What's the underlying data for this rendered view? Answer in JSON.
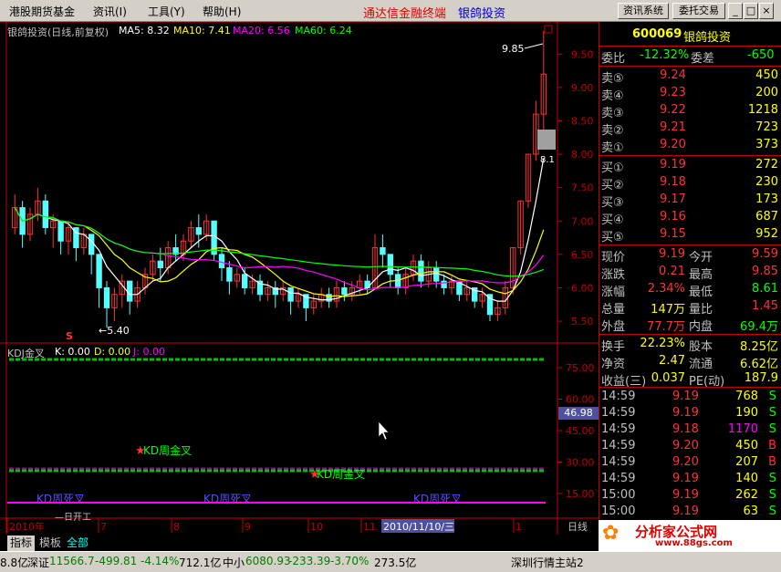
{
  "menu": {
    "items": [
      "港股期货基金",
      "资讯(I)",
      "工具(Y)",
      "帮助(H)"
    ],
    "title_main": "通达信金融终端",
    "title_stock": "银鸽投资",
    "right_buttons": [
      "资讯系统",
      "委托交易"
    ]
  },
  "chart_header": {
    "name": "银鸽投资(日线,前复权)",
    "ma5": "MA5: 8.32",
    "ma10": "MA10: 7.41",
    "ma20": "MA20: 6.56",
    "ma60": "MA60: 6.24"
  },
  "kdj_header": {
    "name": "KDJ金叉",
    "k": "K: 0.00",
    "d": "D: 0.00",
    "j": "J: 0.00"
  },
  "annotations": {
    "high_label": "9.85",
    "low_label": "←5.40",
    "current_price_tag": "8.1",
    "s_marker": "S",
    "kdj_value": "46.98",
    "golden_cross_1": "KD周金叉",
    "golden_cross_2": "KD周金叉",
    "death_cross_1": "KD周死叉",
    "death_cross_2": "KD周死叉",
    "death_cross_3": "KD周死叉",
    "partial_text": "—日开工"
  },
  "colors": {
    "ma5": "#ffffff",
    "ma10": "#ffff00",
    "ma20": "#ff00ff",
    "ma60": "#00ff00",
    "up": "#ff3232",
    "down": "#54ffff",
    "axis": "#c00000"
  },
  "chart_data": {
    "type": "candlestick",
    "price_axis_ticks": [
      "9.50",
      "9.00",
      "8.50",
      "8.00",
      "7.50",
      "7.00",
      "6.50",
      "6.00",
      "5.50"
    ],
    "kdj_axis_ticks": [
      "75.00",
      "60.00",
      "45.00",
      "30.00",
      "15.00"
    ],
    "ylim": [
      5.2,
      9.9
    ],
    "kdj_ylim": [
      5,
      85
    ],
    "x_labels": [
      "2010年",
      "7",
      "8",
      "9",
      "10",
      "11",
      "2010/11/10/三",
      "1",
      "日线"
    ],
    "candles": [
      {
        "o": 6.9,
        "c": 7.2,
        "h": 7.4,
        "l": 6.8
      },
      {
        "o": 7.2,
        "c": 6.8,
        "h": 7.3,
        "l": 6.6
      },
      {
        "o": 6.8,
        "c": 7.1,
        "h": 7.2,
        "l": 6.7
      },
      {
        "o": 7.1,
        "c": 7.3,
        "h": 7.5,
        "l": 7.0
      },
      {
        "o": 7.3,
        "c": 6.9,
        "h": 7.4,
        "l": 6.8
      },
      {
        "o": 6.9,
        "c": 7.0,
        "h": 7.1,
        "l": 6.6
      },
      {
        "o": 7.0,
        "c": 6.7,
        "h": 7.0,
        "l": 6.5
      },
      {
        "o": 6.7,
        "c": 6.9,
        "h": 7.0,
        "l": 6.5
      },
      {
        "o": 6.9,
        "c": 6.6,
        "h": 6.9,
        "l": 6.4
      },
      {
        "o": 6.6,
        "c": 6.8,
        "h": 6.9,
        "l": 6.5
      },
      {
        "o": 6.8,
        "c": 6.5,
        "h": 6.8,
        "l": 6.2
      },
      {
        "o": 6.5,
        "c": 6.0,
        "h": 6.5,
        "l": 5.7
      },
      {
        "o": 6.0,
        "c": 5.7,
        "h": 6.1,
        "l": 5.4
      },
      {
        "o": 5.7,
        "c": 5.9,
        "h": 6.0,
        "l": 5.5
      },
      {
        "o": 5.9,
        "c": 6.1,
        "h": 6.2,
        "l": 5.7
      },
      {
        "o": 6.1,
        "c": 5.8,
        "h": 6.1,
        "l": 5.6
      },
      {
        "o": 5.8,
        "c": 6.0,
        "h": 6.1,
        "l": 5.7
      },
      {
        "o": 6.0,
        "c": 6.2,
        "h": 6.3,
        "l": 5.9
      },
      {
        "o": 6.2,
        "c": 6.4,
        "h": 6.5,
        "l": 6.1
      },
      {
        "o": 6.4,
        "c": 6.3,
        "h": 6.6,
        "l": 6.1
      },
      {
        "o": 6.3,
        "c": 6.6,
        "h": 6.7,
        "l": 6.2
      },
      {
        "o": 6.6,
        "c": 6.5,
        "h": 6.8,
        "l": 6.4
      },
      {
        "o": 6.5,
        "c": 6.7,
        "h": 6.8,
        "l": 6.4
      },
      {
        "o": 6.7,
        "c": 6.9,
        "h": 7.0,
        "l": 6.6
      },
      {
        "o": 6.9,
        "c": 6.8,
        "h": 7.1,
        "l": 6.6
      },
      {
        "o": 6.8,
        "c": 7.0,
        "h": 7.1,
        "l": 6.7
      },
      {
        "o": 7.0,
        "c": 6.5,
        "h": 7.0,
        "l": 6.4
      },
      {
        "o": 6.5,
        "c": 6.3,
        "h": 6.6,
        "l": 6.1
      },
      {
        "o": 6.3,
        "c": 6.1,
        "h": 6.4,
        "l": 5.9
      },
      {
        "o": 6.1,
        "c": 6.2,
        "h": 6.3,
        "l": 6.0
      },
      {
        "o": 6.2,
        "c": 6.0,
        "h": 6.3,
        "l": 5.9
      },
      {
        "o": 6.0,
        "c": 6.1,
        "h": 6.2,
        "l": 5.9
      },
      {
        "o": 6.1,
        "c": 5.9,
        "h": 6.2,
        "l": 5.8
      },
      {
        "o": 5.9,
        "c": 6.0,
        "h": 6.1,
        "l": 5.8
      },
      {
        "o": 6.0,
        "c": 5.9,
        "h": 6.1,
        "l": 5.7
      },
      {
        "o": 5.9,
        "c": 6.0,
        "h": 6.1,
        "l": 5.8
      },
      {
        "o": 6.0,
        "c": 5.8,
        "h": 6.0,
        "l": 5.6
      },
      {
        "o": 5.8,
        "c": 5.9,
        "h": 6.0,
        "l": 5.7
      },
      {
        "o": 5.9,
        "c": 5.7,
        "h": 5.9,
        "l": 5.5
      },
      {
        "o": 5.7,
        "c": 5.8,
        "h": 5.9,
        "l": 5.6
      },
      {
        "o": 5.8,
        "c": 5.9,
        "h": 6.0,
        "l": 5.7
      },
      {
        "o": 5.9,
        "c": 5.8,
        "h": 6.0,
        "l": 5.7
      },
      {
        "o": 5.8,
        "c": 6.0,
        "h": 6.1,
        "l": 5.7
      },
      {
        "o": 6.0,
        "c": 5.9,
        "h": 6.1,
        "l": 5.8
      },
      {
        "o": 5.9,
        "c": 6.0,
        "h": 6.1,
        "l": 5.8
      },
      {
        "o": 6.0,
        "c": 6.1,
        "h": 6.2,
        "l": 5.9
      },
      {
        "o": 6.1,
        "c": 6.0,
        "h": 6.2,
        "l": 5.9
      },
      {
        "o": 6.0,
        "c": 6.6,
        "h": 6.8,
        "l": 6.0
      },
      {
        "o": 6.6,
        "c": 6.5,
        "h": 6.8,
        "l": 6.3
      },
      {
        "o": 6.5,
        "c": 6.2,
        "h": 6.5,
        "l": 6.0
      },
      {
        "o": 6.2,
        "c": 6.0,
        "h": 6.3,
        "l": 5.9
      },
      {
        "o": 6.0,
        "c": 6.2,
        "h": 6.3,
        "l": 5.9
      },
      {
        "o": 6.2,
        "c": 6.4,
        "h": 6.5,
        "l": 6.1
      },
      {
        "o": 6.4,
        "c": 6.1,
        "h": 6.5,
        "l": 6.0
      },
      {
        "o": 6.1,
        "c": 6.3,
        "h": 6.4,
        "l": 6.0
      },
      {
        "o": 6.3,
        "c": 6.1,
        "h": 6.4,
        "l": 6.0
      },
      {
        "o": 6.1,
        "c": 6.0,
        "h": 6.2,
        "l": 5.9
      },
      {
        "o": 6.0,
        "c": 6.1,
        "h": 6.2,
        "l": 5.9
      },
      {
        "o": 6.1,
        "c": 5.9,
        "h": 6.1,
        "l": 5.8
      },
      {
        "o": 5.9,
        "c": 6.0,
        "h": 6.1,
        "l": 5.8
      },
      {
        "o": 6.0,
        "c": 5.8,
        "h": 6.0,
        "l": 5.7
      },
      {
        "o": 5.8,
        "c": 5.9,
        "h": 6.0,
        "l": 5.7
      },
      {
        "o": 5.9,
        "c": 5.6,
        "h": 5.9,
        "l": 5.5
      },
      {
        "o": 5.6,
        "c": 5.7,
        "h": 5.8,
        "l": 5.5
      },
      {
        "o": 5.7,
        "c": 6.0,
        "h": 6.1,
        "l": 5.6
      },
      {
        "o": 6.0,
        "c": 6.6,
        "h": 6.6,
        "l": 5.9
      },
      {
        "o": 6.6,
        "c": 7.3,
        "h": 7.3,
        "l": 6.5
      },
      {
        "o": 7.3,
        "c": 8.0,
        "h": 8.0,
        "l": 7.2
      },
      {
        "o": 8.0,
        "c": 8.6,
        "h": 8.8,
        "l": 7.9
      },
      {
        "o": 8.6,
        "c": 9.2,
        "h": 9.85,
        "l": 8.1
      }
    ],
    "kdj_golden_markers": [
      11,
      27,
      45,
      60
    ],
    "kdj_death_markers": [
      5,
      35,
      50
    ]
  },
  "quote": {
    "code": "600069",
    "name": "银鸽投资",
    "weibi_label": "委比",
    "weibi_value": "-12.32%",
    "weicha_label": "委差",
    "weicha_value": "-650",
    "sell": [
      {
        "label": "卖⑤",
        "price": "9.24",
        "vol": "450"
      },
      {
        "label": "卖④",
        "price": "9.23",
        "vol": "200"
      },
      {
        "label": "卖③",
        "price": "9.22",
        "vol": "1218"
      },
      {
        "label": "卖②",
        "price": "9.21",
        "vol": "723"
      },
      {
        "label": "卖①",
        "price": "9.20",
        "vol": "373"
      }
    ],
    "buy": [
      {
        "label": "买①",
        "price": "9.19",
        "vol": "272"
      },
      {
        "label": "买②",
        "price": "9.18",
        "vol": "230"
      },
      {
        "label": "买③",
        "price": "9.17",
        "vol": "173"
      },
      {
        "label": "买④",
        "price": "9.16",
        "vol": "687"
      },
      {
        "label": "买⑤",
        "price": "9.15",
        "vol": "952"
      }
    ],
    "stats": [
      {
        "l1": "现价",
        "v1": "9.19",
        "l2": "今开",
        "v2": "9.59"
      },
      {
        "l1": "涨跌",
        "v1": "0.21",
        "l2": "最高",
        "v2": "9.85"
      },
      {
        "l1": "涨幅",
        "v1": "2.34%",
        "l2": "最低",
        "v2": "8.61"
      },
      {
        "l1": "总量",
        "v1": "147万",
        "l2": "量比",
        "v2": "1.45"
      },
      {
        "l1": "外盘",
        "v1": "77.7万",
        "l2": "内盘",
        "v2": "69.4万"
      }
    ],
    "stats2": [
      {
        "l1": "换手",
        "v1": "22.23%",
        "l2": "股本",
        "v2": "8.25亿"
      },
      {
        "l1": "净资",
        "v1": "2.47",
        "l2": "流通",
        "v2": "6.62亿"
      },
      {
        "l1": "收益(三)",
        "v1": "0.037",
        "l2": "PE(动)",
        "v2": "187.9"
      }
    ],
    "ticks": [
      {
        "time": "14:59",
        "price": "9.19",
        "vol": "768",
        "side": "S"
      },
      {
        "time": "14:59",
        "price": "9.19",
        "vol": "190",
        "side": "S"
      },
      {
        "time": "14:59",
        "price": "9.18",
        "vol": "1170",
        "side": "S"
      },
      {
        "time": "14:59",
        "price": "9.20",
        "vol": "450",
        "side": "B"
      },
      {
        "time": "14:59",
        "price": "9.20",
        "vol": "207",
        "side": "B"
      },
      {
        "time": "14:59",
        "price": "9.19",
        "vol": "140",
        "side": "S"
      },
      {
        "time": "15:00",
        "price": "9.19",
        "vol": "262",
        "side": "S"
      },
      {
        "time": "15:00",
        "price": "9.19",
        "vol": "63",
        "side": "S"
      }
    ]
  },
  "tabs": [
    "指标",
    "模板",
    "全部"
  ],
  "statusbar": {
    "s0": "8.8亿",
    "sz_label": "深证",
    "sz_index": "11566.7",
    "sz_chg": "-499.81",
    "sz_pct": "-4.14%",
    "sz_amt": "712.1亿",
    "zx_label": "中小",
    "zx_index": "6080.93",
    "zx_chg": "-233.39",
    "zx_pct": "-3.70%",
    "zx_amt": "273.5亿",
    "server": "深圳行情主站2",
    "watermark": "分析家公式网",
    "watermark_url": "www.88gs.com"
  }
}
